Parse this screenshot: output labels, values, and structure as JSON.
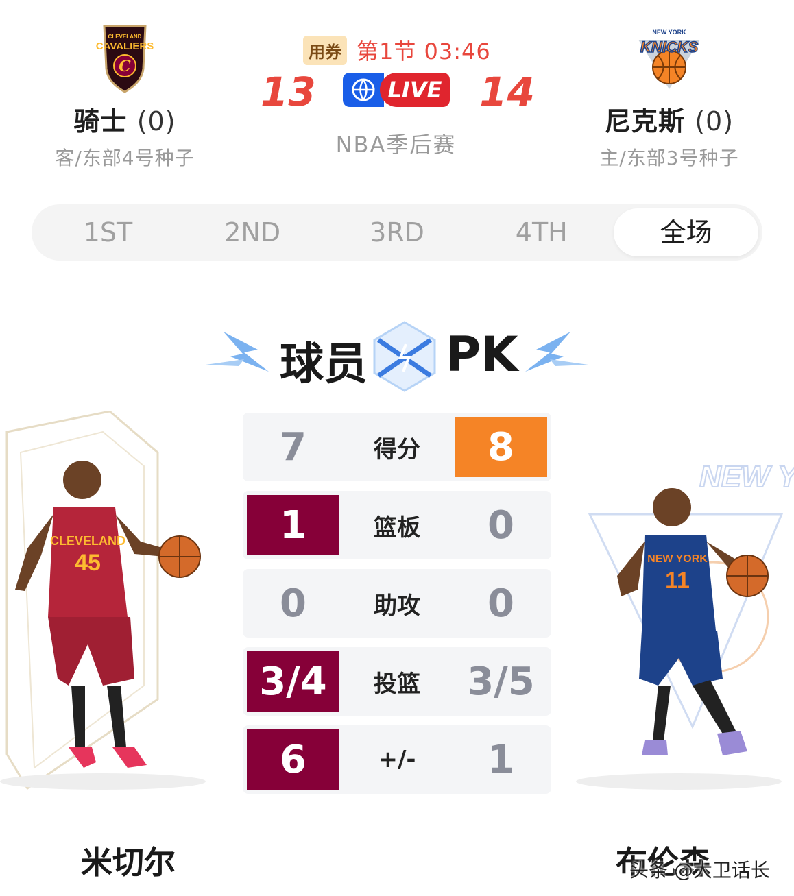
{
  "away_team": {
    "name": "骑士",
    "wins": "(0)",
    "seed": "客/东部4号种子",
    "logo_icon": "cavaliers-logo-icon",
    "color": "#860038"
  },
  "home_team": {
    "name": "尼克斯",
    "wins": "(0)",
    "seed": "主/东部3号种子",
    "logo_icon": "knicks-logo-icon",
    "color": "#f58426"
  },
  "game": {
    "coupon": "用券",
    "period": "第1节 03:46",
    "away_score": "13",
    "home_score": "14",
    "live": "LIVE",
    "league": "NBA季后赛"
  },
  "tabs": [
    {
      "label": "1ST"
    },
    {
      "label": "2ND"
    },
    {
      "label": "3RD"
    },
    {
      "label": "4TH"
    },
    {
      "label": "全场",
      "active": true
    }
  ],
  "pk": {
    "title_left": "球员",
    "title_right": "PK"
  },
  "stats": [
    {
      "label": "得分",
      "left": "7",
      "right": "8",
      "winner": "right"
    },
    {
      "label": "篮板",
      "left": "1",
      "right": "0",
      "winner": "left"
    },
    {
      "label": "助攻",
      "left": "0",
      "right": "0",
      "winner": "none"
    },
    {
      "label": "投篮",
      "left": "3/4",
      "right": "3/5",
      "winner": "left"
    },
    {
      "label": "+/-",
      "left": "6",
      "right": "1",
      "winner": "left"
    }
  ],
  "players": {
    "left": {
      "name": "米切尔",
      "jersey_text": "CLEVELAND",
      "number": "45"
    },
    "right": {
      "name": "布伦森",
      "jersey_text": "NEW YORK",
      "number": "11"
    }
  },
  "watermark": "头条 @大卫话长"
}
